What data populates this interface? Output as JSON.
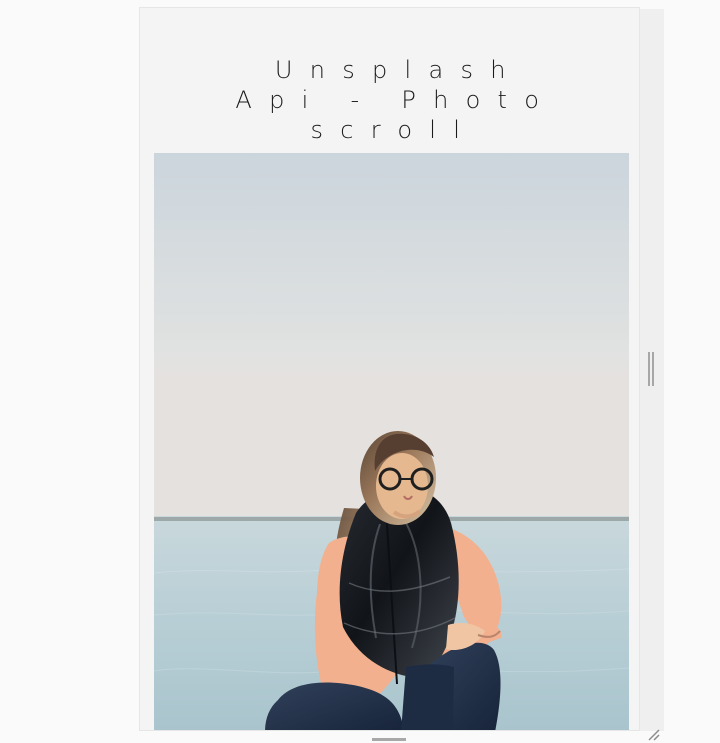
{
  "page": {
    "title_lines": [
      "Unsplash",
      "Api - Photo",
      "scroll"
    ]
  },
  "photo": {
    "icon": "photo-image"
  },
  "window": {
    "scroll_grip_icon": "scrollbar-grip-icon",
    "bottom_handle_icon": "resize-handle-icon",
    "resize_corner_icon": "resize-corner-icon"
  },
  "colors": {
    "panel_background": "#f4f4f4",
    "page_background": "#fafafa",
    "title_text": "#1b1b1b",
    "sky": "#cfd7dc",
    "water": "#b9cfd6",
    "shirt": "#f2b08e",
    "vest": "#1f2328",
    "jeans": "#253449"
  }
}
